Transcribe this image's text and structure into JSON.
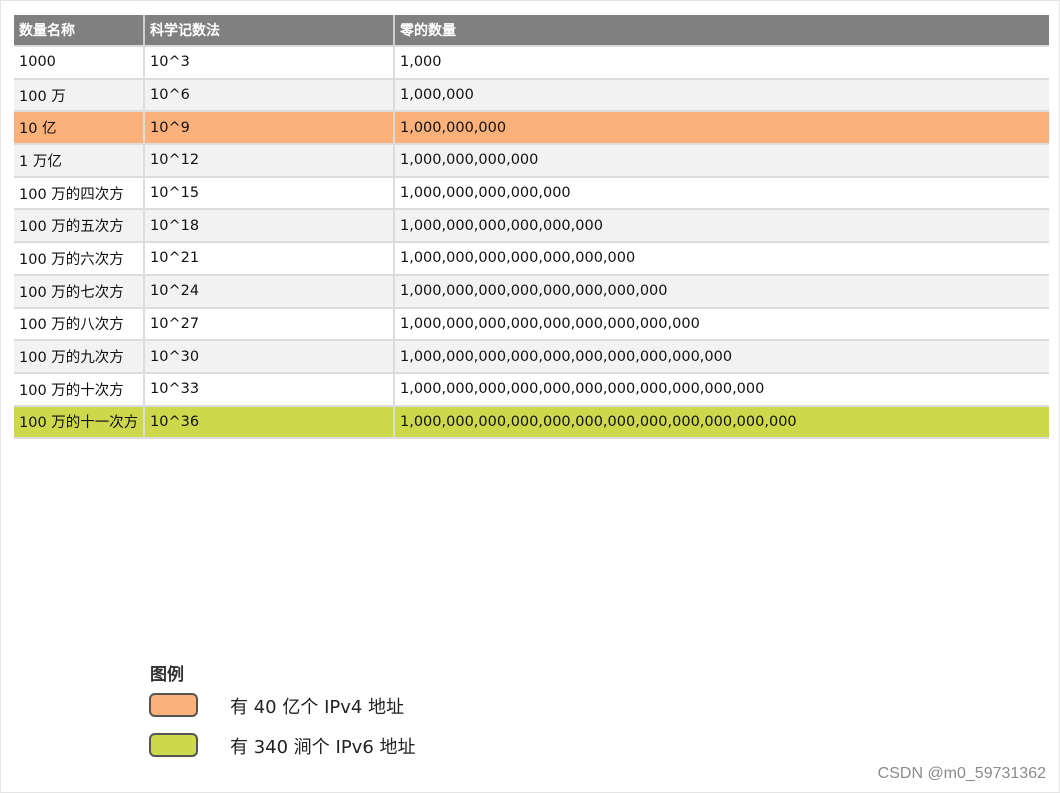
{
  "table": {
    "headers": [
      "数量名称",
      "科学记数法",
      "零的数量"
    ],
    "rows": [
      {
        "name": "1000",
        "sci": "10^3",
        "zeros": "1,000",
        "highlight": "none"
      },
      {
        "name": "100 万",
        "sci": "10^6",
        "zeros": "1,000,000",
        "highlight": "none"
      },
      {
        "name": "10 亿",
        "sci": "10^9",
        "zeros": "1,000,000,000",
        "highlight": "orange"
      },
      {
        "name": "1 万亿",
        "sci": "10^12",
        "zeros": "1,000,000,000,000",
        "highlight": "none"
      },
      {
        "name": "100 万的四次方",
        "sci": "10^15",
        "zeros": "1,000,000,000,000,000",
        "highlight": "none"
      },
      {
        "name": "100 万的五次方",
        "sci": "10^18",
        "zeros": "1,000,000,000,000,000,000",
        "highlight": "none"
      },
      {
        "name": "100 万的六次方",
        "sci": "10^21",
        "zeros": "1,000,000,000,000,000,000,000",
        "highlight": "none"
      },
      {
        "name": "100 万的七次方",
        "sci": "10^24",
        "zeros": "1,000,000,000,000,000,000,000,000",
        "highlight": "none"
      },
      {
        "name": "100 万的八次方",
        "sci": "10^27",
        "zeros": "1,000,000,000,000,000,000,000,000,000",
        "highlight": "none"
      },
      {
        "name": "100 万的九次方",
        "sci": "10^30",
        "zeros": "1,000,000,000,000,000,000,000,000,000,000",
        "highlight": "none"
      },
      {
        "name": "100 万的十次方",
        "sci": "10^33",
        "zeros": "1,000,000,000,000,000,000,000,000,000,000,000",
        "highlight": "none"
      },
      {
        "name": "100 万的十一次方",
        "sci": "10^36",
        "zeros": "1,000,000,000,000,000,000,000,000,000,000,000,000",
        "highlight": "lime"
      }
    ]
  },
  "legend": {
    "title": "图例",
    "items": [
      {
        "color": "#fcb07a",
        "label": "有 40 亿个 IPv4 地址"
      },
      {
        "color": "#cdd94b",
        "label": "有 340 涧个 IPv6 地址"
      }
    ]
  },
  "watermark": "CSDN @m0_59731362",
  "colors": {
    "header_bg": "#808080",
    "row_grey": "#f2f2f2",
    "row_white": "#ffffff",
    "highlight_orange": "#fcb07a",
    "highlight_lime": "#cdd94b"
  }
}
